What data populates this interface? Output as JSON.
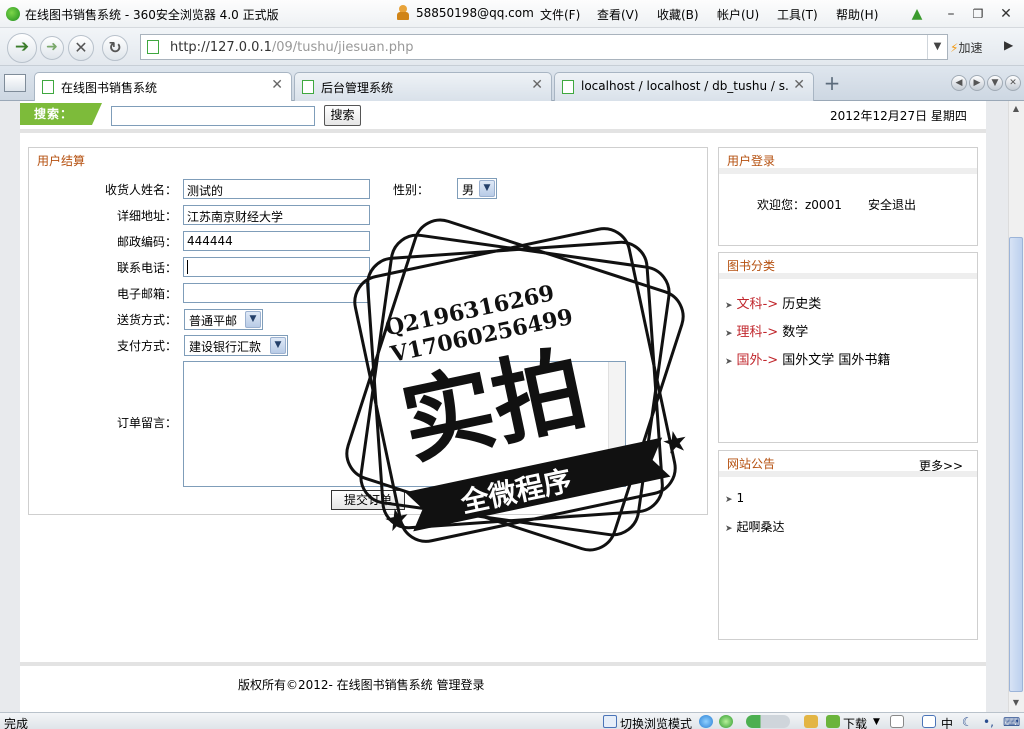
{
  "window": {
    "title": "在线图书销售系统 - 360安全浏览器 4.0 正式版",
    "account": "58850198@qq.com",
    "menu": [
      "文件(F)",
      "查看(V)",
      "收藏(B)",
      "帐户(U)",
      "工具(T)",
      "帮助(H)"
    ]
  },
  "address": {
    "url_prefix": "http://127.0.0.1",
    "url_rest": "/09/tushu/jiesuan.php",
    "speed_label": "加速"
  },
  "tabs": [
    {
      "label": "在线图书销售系统",
      "active": true
    },
    {
      "label": "后台管理系统",
      "active": false
    },
    {
      "label": "localhost / localhost / db_tushu / s...",
      "active": false
    }
  ],
  "search": {
    "label": "搜索：",
    "value": "",
    "button": "搜索"
  },
  "date": "2012年12月27日  星期四",
  "checkout": {
    "title": "用户结算",
    "fields": {
      "name_label": "收货人姓名：",
      "name_value": "测试的",
      "gender_label": "性别：",
      "gender_value": "男",
      "address_label": "详细地址：",
      "address_value": "江苏南京财经大学",
      "zip_label": "邮政编码：",
      "zip_value": "444444",
      "phone_label": "联系电话：",
      "phone_value": "",
      "email_label": "电子邮箱：",
      "email_value": "",
      "delivery_label": "送货方式：",
      "delivery_value": "普通平邮",
      "payment_label": "支付方式：",
      "payment_value": "建设银行汇款",
      "note_label": "订单留言：",
      "note_value": ""
    },
    "submit": "提交订单"
  },
  "login": {
    "title": "用户登录",
    "welcome": "欢迎您：z0001",
    "logout": "安全退出"
  },
  "categories": {
    "title": "图书分类",
    "items": [
      {
        "name": "文科",
        "arrow": "->",
        "subs": "历史类"
      },
      {
        "name": "理科",
        "arrow": "->",
        "subs": "数学"
      },
      {
        "name": "国外",
        "arrow": "->",
        "subs": "国外文学  国外书籍"
      }
    ]
  },
  "notices": {
    "title": "网站公告",
    "more": "更多>>",
    "items": [
      "1",
      "起啊桑达"
    ]
  },
  "footer": "版权所有©2012- 在线图书销售系统 管理登录",
  "status": {
    "left": "完成",
    "mode": "切换浏览模式",
    "download": "下载",
    "ime": "中"
  },
  "watermark": {
    "line1": "Q2196316269",
    "line2": "V17060256499",
    "big": "实拍",
    "banner": "全微程序"
  },
  "colors": {
    "accent_green": "#7dbb3a",
    "panel_title": "#b5500f",
    "category_red": "#c0262c"
  }
}
